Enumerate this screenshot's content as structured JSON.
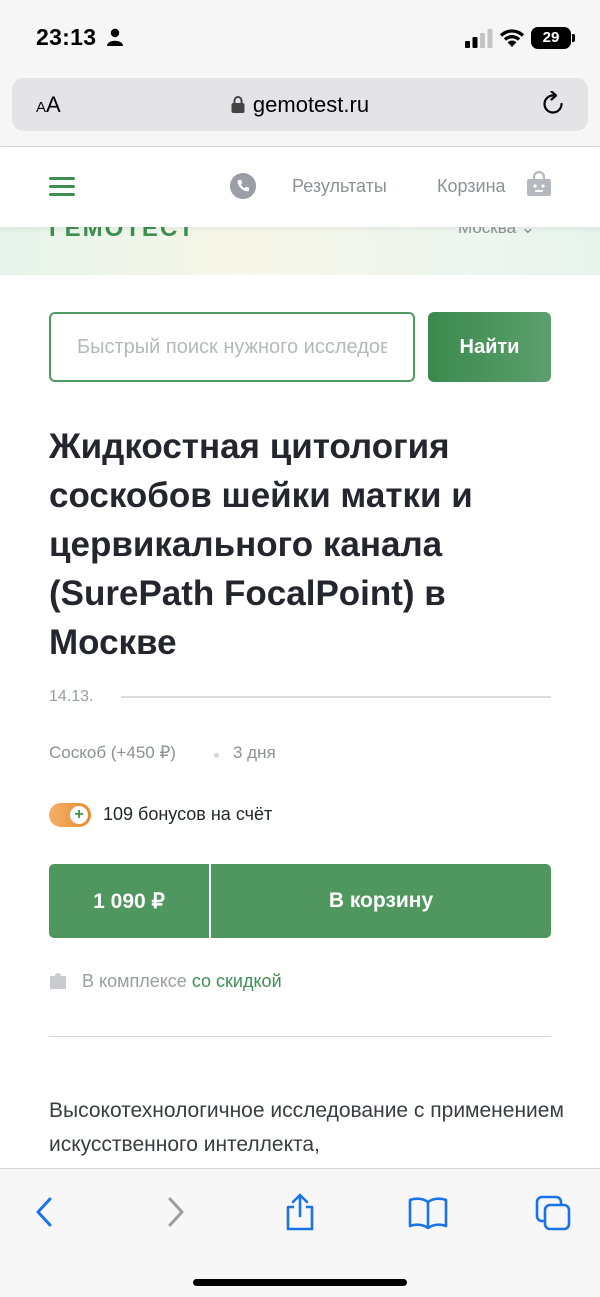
{
  "status_bar": {
    "time": "23:13",
    "battery": "29"
  },
  "browser": {
    "text_size_label_small": "A",
    "text_size_label_large": "A",
    "domain": "gemotest.ru"
  },
  "header": {
    "nav_results": "Результаты",
    "nav_cart": "Корзина"
  },
  "hero": {
    "logo_text": "ГЕМОТЕСТ",
    "city": "Москва ⌄"
  },
  "search": {
    "placeholder": "Быстрый поиск нужного исследования",
    "button_label": "Найти"
  },
  "product": {
    "title": "Жидкостная цитология соскобов шейки матки и цервикального канала (SurePath FocalPoint) в Москве",
    "code": "14.13.",
    "biomaterial": "Соскоб (+450 ₽)",
    "duration": "3 дня",
    "bonus_text": "109 бонусов на счёт",
    "price": "1 090 ₽",
    "add_to_cart": "В корзину",
    "complex_prefix": "В комплексе ",
    "complex_link": "со скидкой",
    "description": "Высокотехнологичное исследование с применением искусственного интеллекта,"
  },
  "colors": {
    "brand_green": "#4f965f",
    "bonus_orange": "#e98a2d"
  },
  "toolbar_icons": [
    "back-icon",
    "forward-icon",
    "share-icon",
    "bookmarks-icon",
    "tabs-icon"
  ]
}
